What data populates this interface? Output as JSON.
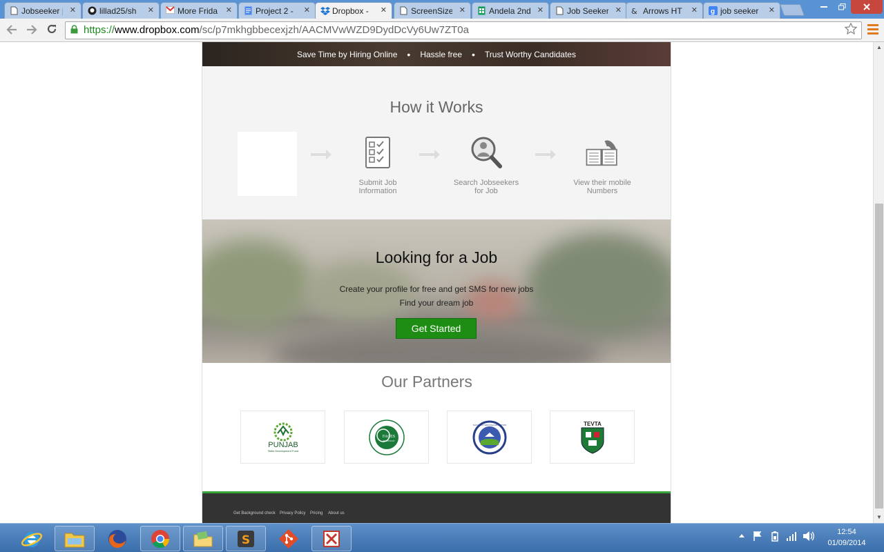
{
  "browser": {
    "tabs": [
      {
        "label": "Jobseeker |",
        "icon": "document-icon",
        "active": false
      },
      {
        "label": "lillad25/sh",
        "icon": "github-icon",
        "active": false
      },
      {
        "label": "More Frida",
        "icon": "gmail-icon",
        "active": false
      },
      {
        "label": "Project 2 -",
        "icon": "docs-icon",
        "active": false
      },
      {
        "label": "Dropbox -",
        "icon": "dropbox-icon",
        "active": true
      },
      {
        "label": "ScreenSize",
        "icon": "document-icon",
        "active": false
      },
      {
        "label": "Andela 2nd",
        "icon": "sheets-icon",
        "active": false
      },
      {
        "label": "Job Seeker",
        "icon": "document-icon",
        "active": false
      },
      {
        "label": "Arrows HT",
        "icon": "arrows-icon",
        "active": false
      },
      {
        "label": "job seeker",
        "icon": "google-icon",
        "active": false
      }
    ],
    "close_glyph": "✕",
    "url_scheme": "https://",
    "url_host": "www.dropbox.com",
    "url_path": "/sc/p7mkhgbbecexjzh/AACMVwWZD9DydDcVy6Uw7ZT0a"
  },
  "page": {
    "hero_items": [
      "Save Time by Hiring Online",
      "Hassle free",
      "Trust Worthy Candidates"
    ],
    "how_title": "How it Works",
    "steps": [
      {
        "line1": "Submit Job",
        "line2": "Information"
      },
      {
        "line1": "Search Jobseekers",
        "line2": "for Job"
      },
      {
        "line1": "View their mobile",
        "line2": "Numbers"
      }
    ],
    "looking_title": "Looking for a Job",
    "looking_line1": "Create your profile for free and get SMS for new jobs",
    "looking_line2": "Find your dream job",
    "cta_label": "Get Started",
    "partners_title": "Our Partners",
    "partners": [
      {
        "name": "PUNJAB",
        "sub": "Skills Development Fund"
      },
      {
        "name": "FACES",
        "sub": "PAKISTAN"
      },
      {
        "name": "SUCCESS THROUGH EDUCATION",
        "sub": ""
      },
      {
        "name": "TEVTA",
        "sub": ""
      }
    ],
    "footer_links": [
      "Get Background check",
      "Privacy Policy",
      "Pricing",
      "About us"
    ]
  },
  "taskbar": {
    "apps": [
      "ie-icon",
      "explorer-icon",
      "firefox-icon",
      "chrome-icon",
      "folder-icon",
      "sublime-icon",
      "git-icon",
      "kingsoft-icon"
    ],
    "time": "12:54",
    "date": "01/09/2014"
  },
  "colors": {
    "cta_green": "#1d8e13",
    "footer_bg": "#333333",
    "footer_accent": "#3aa53a",
    "url_green": "#1f8a1f"
  }
}
